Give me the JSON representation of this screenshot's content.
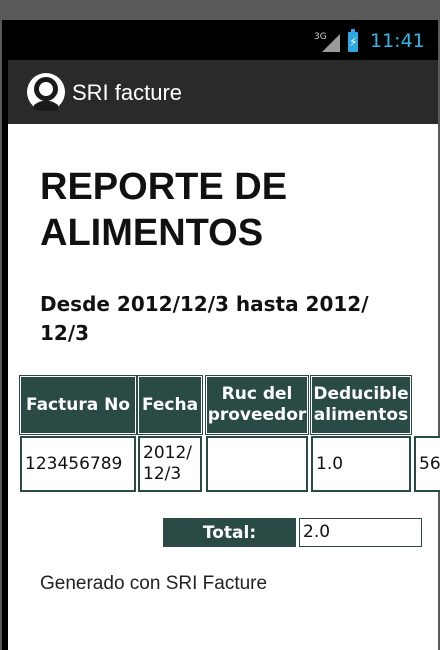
{
  "statusbar": {
    "network": "3G",
    "time": "11:41"
  },
  "actionbar": {
    "title": "SRI facture",
    "icon": "app-avatar-icon"
  },
  "report": {
    "title": "REPORTE DE ALIMENTOS",
    "range": "Desde 2012/12/3 hasta 2012/ 12/3",
    "table": {
      "headers": [
        "Factura No",
        "Fecha",
        "Ruc del proveedor",
        "Deducible alimentos",
        ""
      ],
      "rows": [
        [
          "123456789",
          "2012/ 12/3",
          "",
          "1.0",
          "56"
        ]
      ]
    },
    "total_label": "Total:",
    "total_value": "2.0",
    "footer": "Generado con SRI Facture"
  },
  "colors": {
    "header_bg": "#2a4a46",
    "actionbar_bg": "#2a2a2a",
    "clock": "#33b5e5",
    "battery": "#2ea8e0"
  }
}
